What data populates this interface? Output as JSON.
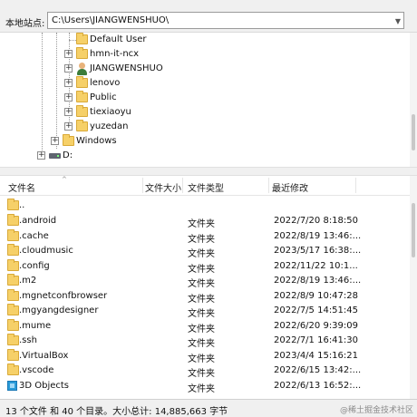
{
  "pathbar": {
    "label": "本地站点:",
    "path": "C:\\Users\\JIANGWENSHUO\\"
  },
  "tree": {
    "items": [
      {
        "label": "Default User",
        "icon": "folder-icon"
      },
      {
        "label": "hmn-it-ncx",
        "icon": "folder-icon"
      },
      {
        "label": "JIANGWENSHUO",
        "icon": "user-folder-icon"
      },
      {
        "label": "lenovo",
        "icon": "folder-icon"
      },
      {
        "label": "Public",
        "icon": "folder-icon"
      },
      {
        "label": "tiexiaoyu",
        "icon": "folder-icon"
      },
      {
        "label": "yuzedan",
        "icon": "folder-icon"
      },
      {
        "label": "Windows",
        "icon": "folder-icon"
      },
      {
        "label": "D:",
        "icon": "drive-icon"
      }
    ]
  },
  "columns": {
    "name": "文件名",
    "size": "文件大小",
    "type": "文件类型",
    "modified": "最近修改"
  },
  "files": [
    {
      "name": "..",
      "type": "",
      "modified": ""
    },
    {
      "name": ".android",
      "type": "文件夹",
      "modified": "2022/7/20 8:18:50"
    },
    {
      "name": ".cache",
      "type": "文件夹",
      "modified": "2022/8/19 13:46:..."
    },
    {
      "name": ".cloudmusic",
      "type": "文件夹",
      "modified": "2023/5/17 16:38:..."
    },
    {
      "name": ".config",
      "type": "文件夹",
      "modified": "2022/11/22 10:1..."
    },
    {
      "name": ".m2",
      "type": "文件夹",
      "modified": "2022/8/19 13:46:..."
    },
    {
      "name": ".mgnetconfbrowser",
      "type": "文件夹",
      "modified": "2022/8/9 10:47:28"
    },
    {
      "name": ".mgyangdesigner",
      "type": "文件夹",
      "modified": "2022/7/5 14:51:45"
    },
    {
      "name": ".mume",
      "type": "文件夹",
      "modified": "2022/6/20 9:39:09"
    },
    {
      "name": ".ssh",
      "type": "文件夹",
      "modified": "2022/7/1 16:41:30"
    },
    {
      "name": ".VirtualBox",
      "type": "文件夹",
      "modified": "2023/4/4 15:16:21"
    },
    {
      "name": ".vscode",
      "type": "文件夹",
      "modified": "2022/6/15 13:42:..."
    },
    {
      "name": "3D Objects",
      "type": "文件夹",
      "modified": "2022/6/13 16:52:..."
    }
  ],
  "status": {
    "text": "13 个文件 和 40 个目录。大小总计: 14,885,663 字节",
    "watermark": "@稀土掘金技术社区"
  }
}
